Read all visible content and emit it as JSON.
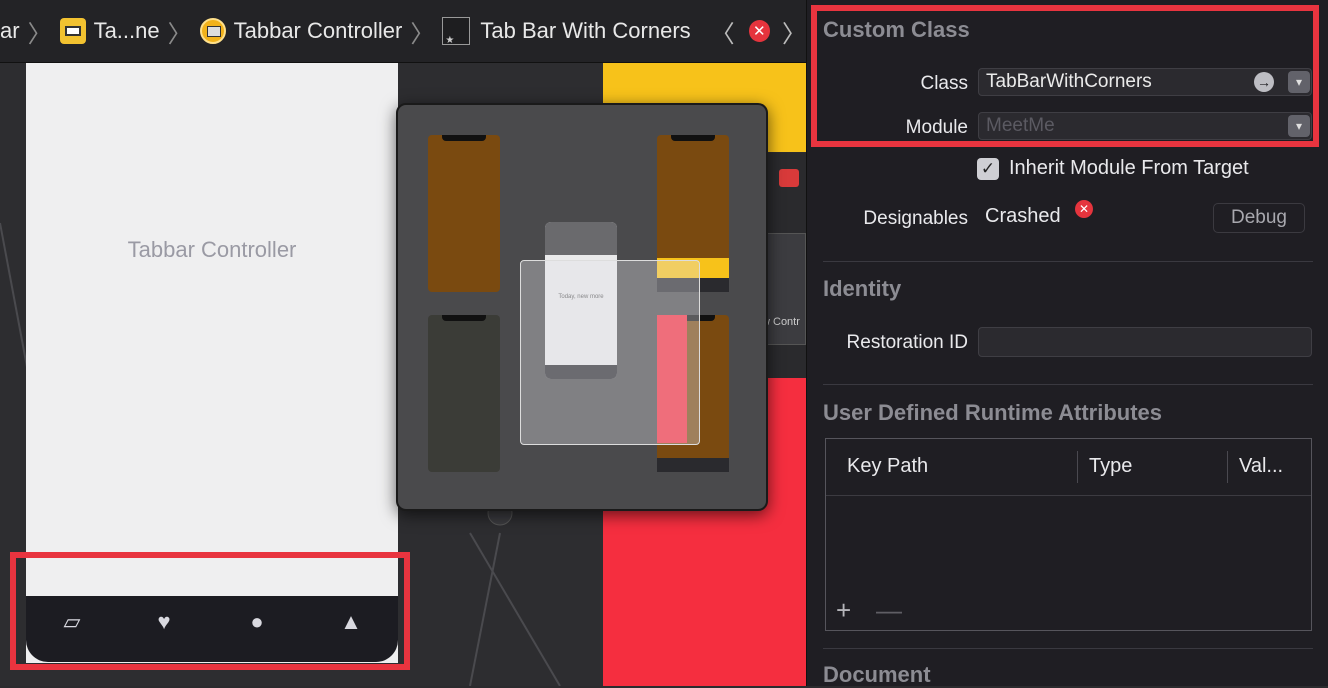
{
  "jumpbar": {
    "crumbs": [
      {
        "label": "ar",
        "icon": "none"
      },
      {
        "label": "Ta...ne",
        "icon": "storyboard-file-icon"
      },
      {
        "label": "Tabbar Controller",
        "icon": "scene-icon"
      },
      {
        "label": "Tab Bar With Corners",
        "icon": "view-icon"
      }
    ],
    "separator": "〉",
    "back": "〈",
    "forward": "〉",
    "error_badge": "✕"
  },
  "canvas": {
    "scene_title": "Tabbar Controller",
    "tab_icons": [
      "cards-icon",
      "heart-icon",
      "chat-icon",
      "bell-icon"
    ],
    "mid_label": "w Contr",
    "mini_phone_text": "Today, new more"
  },
  "inspector": {
    "custom_class": {
      "title": "Custom Class",
      "class_label": "Class",
      "class_value": "TabBarWithCorners",
      "module_label": "Module",
      "module_placeholder": "MeetMe",
      "inherit_label": "Inherit Module From Target",
      "inherit_checked": true,
      "designables_label": "Designables",
      "designables_value": "Crashed",
      "debug_label": "Debug"
    },
    "identity": {
      "title": "Identity",
      "restoration_label": "Restoration ID",
      "restoration_value": ""
    },
    "runtime_attributes": {
      "title": "User Defined Runtime Attributes",
      "columns": [
        "Key Path",
        "Type",
        "Val..."
      ],
      "add": "+",
      "remove": "—"
    },
    "document": {
      "title": "Document"
    }
  },
  "colors": {
    "highlight": "#e8343f",
    "yellow": "#f7c21a",
    "red": "#f52e3f",
    "brown": "#7a4a10"
  }
}
